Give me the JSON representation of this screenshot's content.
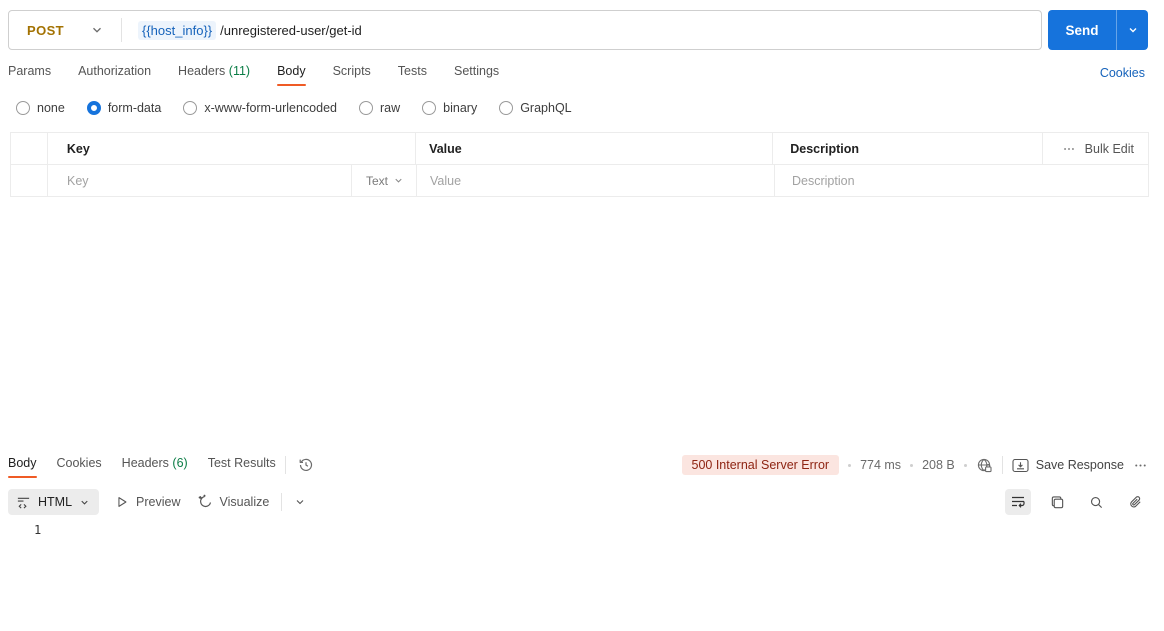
{
  "request": {
    "method": "POST",
    "url_variable": "{{host_info}}",
    "url_path": "/unregistered-user/get-id",
    "send_label": "Send",
    "cookies_link": "Cookies",
    "tabs": [
      {
        "label": "Params"
      },
      {
        "label": "Authorization"
      },
      {
        "label": "Headers",
        "count": "(11)"
      },
      {
        "label": "Body"
      },
      {
        "label": "Scripts"
      },
      {
        "label": "Tests"
      },
      {
        "label": "Settings"
      }
    ],
    "active_tab": "Body",
    "body_types": [
      "none",
      "form-data",
      "x-www-form-urlencoded",
      "raw",
      "binary",
      "GraphQL"
    ],
    "selected_body_type": "form-data",
    "table": {
      "headers": {
        "key": "Key",
        "value": "Value",
        "description": "Description"
      },
      "bulk_edit_label": "Bulk Edit",
      "row": {
        "key_placeholder": "Key",
        "value_placeholder": "Value",
        "description_placeholder": "Description",
        "type_selected": "Text"
      }
    }
  },
  "response": {
    "tabs": [
      {
        "label": "Body"
      },
      {
        "label": "Cookies"
      },
      {
        "label": "Headers",
        "count": "(6)"
      },
      {
        "label": "Test Results"
      }
    ],
    "active_tab": "Body",
    "status": "500 Internal Server Error",
    "time": "774 ms",
    "size": "208 B",
    "save_response_label": "Save Response",
    "format_selected": "HTML",
    "preview_label": "Preview",
    "visualize_label": "Visualize",
    "editor_line_number": "1"
  },
  "colors": {
    "method_post": "#a37202",
    "send_button": "#1673dc",
    "accent_orange": "#ef5b25",
    "count_green": "#0b7d46",
    "link_blue": "#1663bb",
    "status_error_bg": "#fbe5e0",
    "status_error_text": "#8e2412"
  },
  "icons": [
    "chevron-down",
    "history",
    "globe-lock",
    "save-response",
    "more-dots",
    "code-format",
    "play",
    "visualize-wand",
    "wrap-text",
    "copy",
    "search",
    "link-attachment"
  ]
}
